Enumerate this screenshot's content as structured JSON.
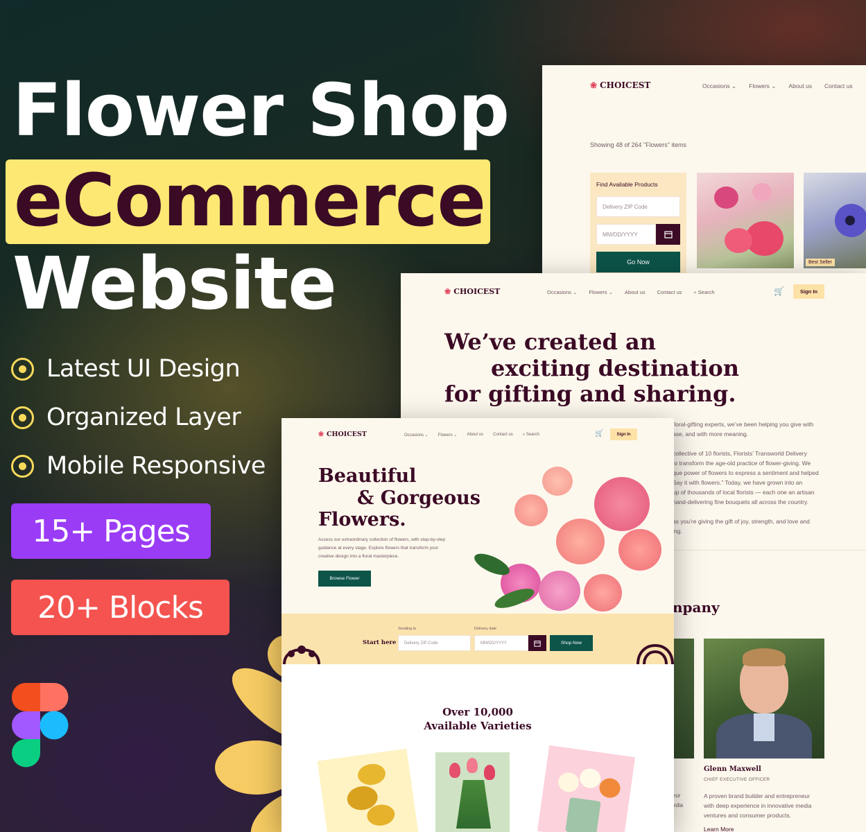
{
  "promo": {
    "title_line1": "Flower Shop",
    "title_line2": "eCommerce",
    "title_line3": "Website",
    "features": [
      "Latest UI Design",
      "Organized Layer",
      "Mobile Responsive"
    ],
    "badge_pages": "15+ Pages",
    "badge_blocks": "20+ Blocks",
    "highlight_color": "#fde874",
    "pages_badge_color": "#9a3cf5",
    "blocks_badge_color": "#f4534f"
  },
  "brand": {
    "name": "CHOICEST",
    "icon": "flower-logo-icon"
  },
  "nav": {
    "occasions": "Occasions",
    "flowers": "Flowers",
    "about": "About us",
    "contact": "Contact us",
    "search": "Search",
    "sign_in": "Sign In"
  },
  "shop_page": {
    "showing": "Showing 48 of 264 \"Flowers\" items",
    "filter_title": "Find Available Products",
    "zip_placeholder": "Delivery ZIP Code",
    "date_placeholder": "MM/DD/YYYY",
    "go_now": "Go Now",
    "best_seller": "Best Seller"
  },
  "about_page": {
    "headline_1": "We’ve created an",
    "headline_2": "exciting destination",
    "headline_3": "for gifting and sharing.",
    "para1_l1": "floral-gifting experts, we’ve been helping you give with",
    "para1_l2": "ase, and with more meaning.",
    "para2_l1": "collective of 10 florists, Florists’ Transworld Delivery",
    "para2_l2": "to transform the age-old practice of flower-giving. We",
    "para2_l3": "que power of flowers to express a sentiment and helped",
    "para2_l4": "Say it with flowers.” Today, we have grown into an",
    "para2_l5": "up of thousands of local florists — each one an artisan",
    "para2_l6": "hand-delivering fine bouquets all across the country.",
    "para3_l1": "as you’re giving the gift of joy, strength, and love and",
    "para3_l2": "ing.",
    "company_heading": "npany",
    "person_name": "Glenn Maxwell",
    "person_role": "CHIEF EXECUTIVE OFFICER",
    "person_bio_l1": "A proven brand builder and entrepreneur",
    "person_bio_l2": "with deep experience in innovative media",
    "person_bio_l3": "ventures and consumer products.",
    "side_frag_1": "eur",
    "side_frag_2": "edia",
    "learn_more": "Learn More"
  },
  "home_page": {
    "hero_1": "Beautiful",
    "hero_2": "& Gorgeous",
    "hero_3": "Flowers.",
    "hero_desc_l1": "Access our extraordinary collection of flowers, with step-by-step",
    "hero_desc_l2": "guidance at every stage. Explore flowers that transform your",
    "hero_desc_l3": "creative design into a floral masterpiece.",
    "browse": "Browse Flower",
    "start_here": "Start here",
    "sending_to": "Sending to",
    "delivery_date": "Delivery date",
    "zip_placeholder": "Delivery ZIP Code",
    "date_placeholder": "MM/DD/YYYY",
    "shop_now": "Shop Now",
    "varieties_1": "Over 10,000",
    "varieties_2": "Available Varieties"
  },
  "colors": {
    "brand_plum": "#3b0a25",
    "brand_green": "#0d5449",
    "cream": "#fdf8ee",
    "signin_bg": "#fde2a7"
  }
}
